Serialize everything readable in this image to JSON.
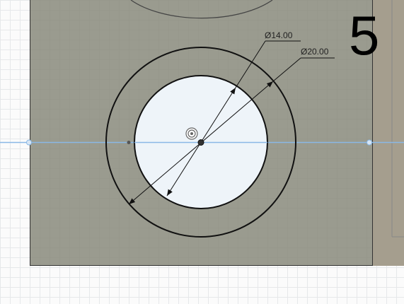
{
  "sketch": {
    "dimensions": {
      "inner_diameter": "Ø14.00",
      "outer_diameter": "Ø20.00"
    },
    "step_number": "5",
    "colors": {
      "body_face": "#9a9b8f",
      "inner_region": "#eef4f9",
      "axis_line": "#8ab8e6",
      "sketch_line": "#111111",
      "grid": "#e6e8ea"
    },
    "icons": [
      "origin-icon",
      "center-point-icon"
    ]
  }
}
